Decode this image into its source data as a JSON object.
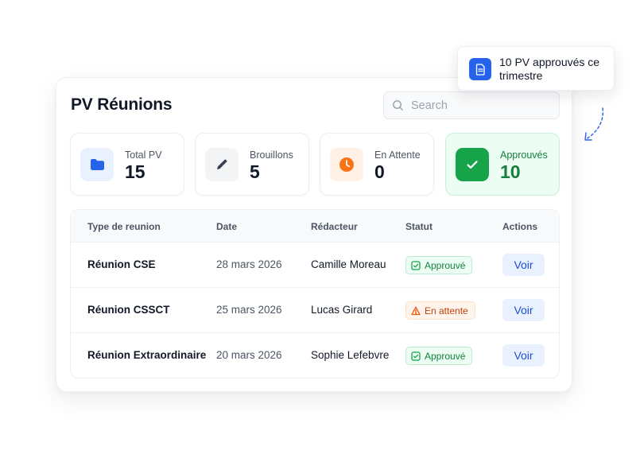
{
  "header": {
    "title": "PV Réunions"
  },
  "search": {
    "placeholder": "Search"
  },
  "stats": [
    {
      "label": "Total PV",
      "value": "15",
      "icon": "folder-icon"
    },
    {
      "label": "Brouillons",
      "value": "5",
      "icon": "pencil-icon"
    },
    {
      "label": "En Attente",
      "value": "0",
      "icon": "clock-icon"
    },
    {
      "label": "Approuvés",
      "value": "10",
      "icon": "check-icon"
    }
  ],
  "table": {
    "headers": [
      "Type de reunion",
      "Date",
      "Rédacteur",
      "Statut",
      "Actions"
    ],
    "rows": [
      {
        "type": "Réunion CSE",
        "date": "28 mars 2026",
        "author": "Camille Moreau",
        "status": "Approuvé",
        "action": "Voir"
      },
      {
        "type": "Réunion CSSCT",
        "date": "25 mars 2026",
        "author": "Lucas Girard",
        "status": "En attente",
        "action": "Voir"
      },
      {
        "type": "Réunion Extraordinaire",
        "date": "20 mars 2026",
        "author": "Sophie Lefebvre",
        "status": "Approuvé",
        "action": "Voir"
      }
    ]
  },
  "toast": {
    "text": "10 PV approuvés ce trimestre",
    "icon": "document-icon"
  },
  "colors": {
    "accent": "#2563eb",
    "success": "#16a34a",
    "warning": "#f97316"
  }
}
